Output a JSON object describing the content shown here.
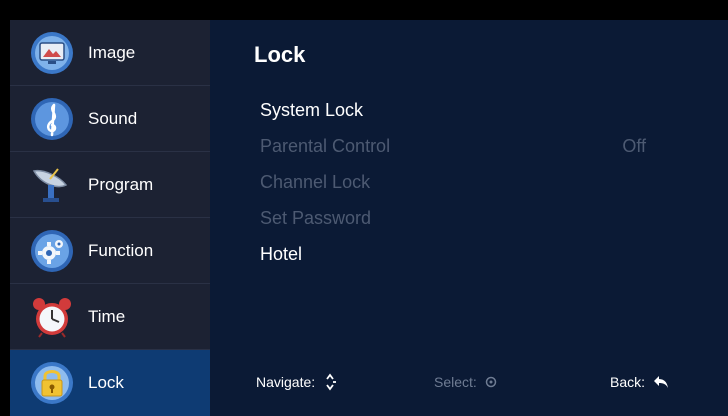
{
  "sidebar": {
    "items": [
      {
        "label": "Image",
        "icon": "monitor-icon",
        "active": false
      },
      {
        "label": "Sound",
        "icon": "music-note-icon",
        "active": false
      },
      {
        "label": "Program",
        "icon": "satellite-dish-icon",
        "active": false
      },
      {
        "label": "Function",
        "icon": "gear-icon",
        "active": false
      },
      {
        "label": "Time",
        "icon": "alarm-clock-icon",
        "active": false
      },
      {
        "label": "Lock",
        "icon": "padlock-icon",
        "active": true
      }
    ]
  },
  "panel": {
    "title": "Lock",
    "items": [
      {
        "label": "System Lock",
        "value": "",
        "enabled": true
      },
      {
        "label": "Parental Control",
        "value": "Off",
        "enabled": false
      },
      {
        "label": "Channel Lock",
        "value": "",
        "enabled": false
      },
      {
        "label": "Set Password",
        "value": "",
        "enabled": false
      },
      {
        "label": "Hotel",
        "value": "",
        "enabled": true
      }
    ]
  },
  "footer": {
    "navigate_label": "Navigate:",
    "select_label": "Select:",
    "back_label": "Back:"
  },
  "colors": {
    "sidebar_bg": "#1c2233",
    "active_bg": "#0e3b73",
    "panel_bg": "#0b1a35",
    "disabled_text": "#4d5a72"
  }
}
